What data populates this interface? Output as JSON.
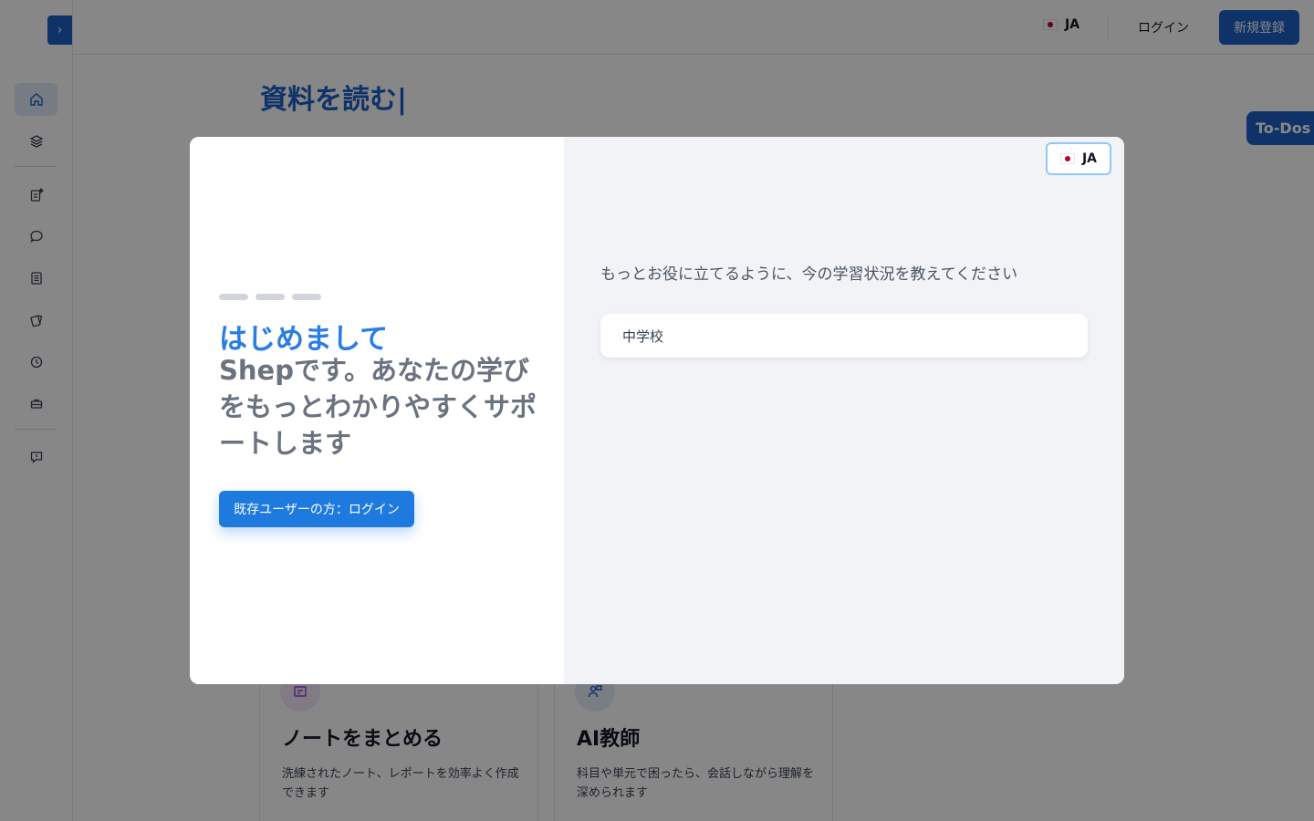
{
  "sidebar": {
    "toggle_icon": "chevron-right-icon",
    "items": [
      {
        "icon": "home-icon",
        "active": true
      },
      {
        "icon": "layers-icon",
        "active": false
      },
      {
        "icon": "document-sparkle-icon",
        "active": false
      },
      {
        "icon": "chat-bubble-icon",
        "active": false
      },
      {
        "icon": "notes-icon",
        "active": false
      },
      {
        "icon": "cards-icon",
        "active": false
      },
      {
        "icon": "clock-icon",
        "active": false
      },
      {
        "icon": "briefcase-icon",
        "active": false
      },
      {
        "icon": "feedback-icon",
        "active": false
      }
    ]
  },
  "topbar": {
    "lang_label": "JA",
    "login_label": "ログイン",
    "signup_label": "新規登録"
  },
  "main": {
    "heading": "資料を読む|",
    "todo_label": "To-Dos",
    "cards": [
      {
        "title": "ノートをまとめる",
        "description": "洗練されたノート、レポートを効率よく作成できます",
        "icon": "note-icon"
      },
      {
        "title": "AI教師",
        "description": "科目や単元で困ったら、会話しながら理解を深められます",
        "icon": "teacher-icon"
      }
    ]
  },
  "modal": {
    "lang_label": "JA",
    "welcome_title": "はじめまして",
    "welcome_body": "Shepです。あなたの学びをもっとわかりやすくサポートします",
    "login_button": "既存ユーザーの方：ログイン",
    "question": "もっとお役に立てるように、今の学習状況を教えてください",
    "option_selected": "中学校"
  },
  "colors": {
    "brand": "#1d5fc4",
    "accent": "#1f7ae0",
    "title_blue": "#2a7de1"
  }
}
